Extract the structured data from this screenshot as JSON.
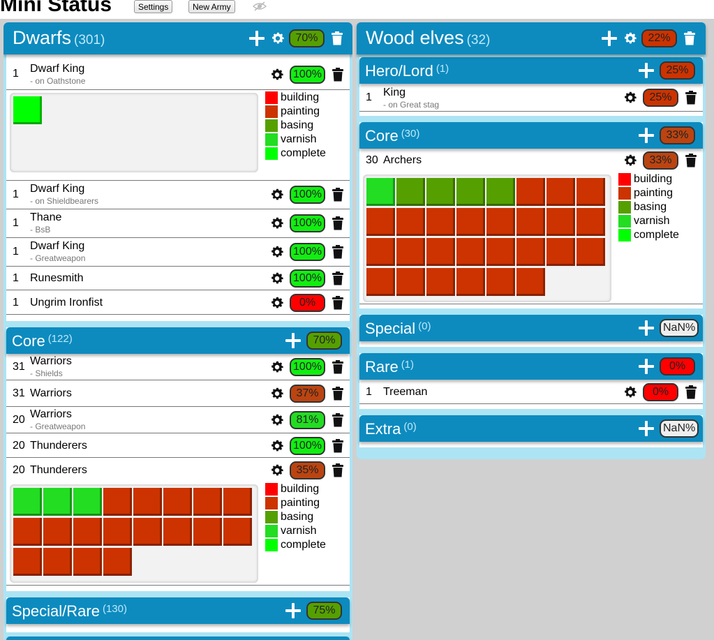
{
  "app": {
    "title": "Mini Status",
    "settings_label": "Settings",
    "new_army_label": "New Army"
  },
  "status_colors": {
    "building": "#ff0000",
    "painting": "#cc3300",
    "basing": "#55a000",
    "varnish": "#22dd22",
    "complete": "#00ff00"
  },
  "pct_colors": {
    "100%": "#11ee11",
    "81%": "#22dd22",
    "75%": "#55a000",
    "70%": "#55a000",
    "37%": "#bb4411",
    "35%": "#bb4411",
    "33%": "#bb4411",
    "25%": "#cc3300",
    "22%": "#cc3300",
    "0%": "#ff0000",
    "NaN%": "#eeeeee"
  },
  "legend": [
    "building",
    "painting",
    "basing",
    "varnish",
    "complete"
  ],
  "armies": [
    {
      "name": "Dwarfs",
      "count": "(301)",
      "pct": "70%",
      "sections": [
        {
          "name": "",
          "count": "",
          "pct": "",
          "units": [
            {
              "qty": "1",
              "name": "Dwarf King",
              "sub": "- on Oathstone",
              "pct": "100%",
              "grid": [
                "complete"
              ]
            },
            {
              "qty": "1",
              "name": "Dwarf King",
              "sub": "- on Shieldbearers",
              "pct": "100%"
            },
            {
              "qty": "1",
              "name": "Thane",
              "sub": "- BsB",
              "pct": "100%"
            },
            {
              "qty": "1",
              "name": "Dwarf King",
              "sub": "- Greatweapon",
              "pct": "100%"
            },
            {
              "qty": "1",
              "name": "Runesmith",
              "sub": "",
              "pct": "100%"
            },
            {
              "qty": "1",
              "name": "Ungrim Ironfist",
              "sub": "",
              "pct": "0%"
            }
          ]
        },
        {
          "name": "Core",
          "count": "(122)",
          "pct": "70%",
          "units": [
            {
              "qty": "31",
              "name": "Warriors",
              "sub": "- Shields",
              "pct": "100%"
            },
            {
              "qty": "31",
              "name": "Warriors",
              "sub": "",
              "pct": "37%"
            },
            {
              "qty": "20",
              "name": "Warriors",
              "sub": "- Greatweapon",
              "pct": "81%"
            },
            {
              "qty": "20",
              "name": "Thunderers",
              "sub": "",
              "pct": "100%"
            },
            {
              "qty": "20",
              "name": "Thunderers",
              "sub": "",
              "pct": "35%",
              "grid": [
                "varnish",
                "varnish",
                "varnish",
                "painting",
                "painting",
                "painting",
                "painting",
                "painting",
                "painting",
                "painting",
                "painting",
                "painting",
                "painting",
                "painting",
                "painting",
                "painting",
                "painting",
                "painting",
                "painting",
                "painting"
              ]
            }
          ]
        },
        {
          "name": "Special/Rare",
          "count": "(130)",
          "pct": "75%",
          "units": []
        }
      ]
    },
    {
      "name": "Wood elves",
      "count": "(32)",
      "pct": "22%",
      "sections": [
        {
          "name": "Hero/Lord",
          "count": "(1)",
          "pct": "25%",
          "units": [
            {
              "qty": "1",
              "name": "King",
              "sub": "- on Great stag",
              "pct": "25%"
            }
          ]
        },
        {
          "name": "Core",
          "count": "(30)",
          "pct": "33%",
          "units": [
            {
              "qty": "30",
              "name": "Archers",
              "sub": "",
              "pct": "33%",
              "grid": [
                "varnish",
                "basing",
                "basing",
                "basing",
                "basing",
                "painting",
                "painting",
                "painting",
                "painting",
                "painting",
                "painting",
                "painting",
                "painting",
                "painting",
                "painting",
                "painting",
                "painting",
                "painting",
                "painting",
                "painting",
                "painting",
                "painting",
                "painting",
                "painting",
                "painting",
                "painting",
                "painting",
                "painting",
                "painting",
                "painting"
              ]
            }
          ]
        },
        {
          "name": "Special",
          "count": "(0)",
          "pct": "NaN%",
          "units": []
        },
        {
          "name": "Rare",
          "count": "(1)",
          "pct": "0%",
          "units": [
            {
              "qty": "1",
              "name": "Treeman",
              "sub": "",
              "pct": "0%"
            }
          ]
        },
        {
          "name": "Extra",
          "count": "(0)",
          "pct": "NaN%",
          "units": []
        }
      ]
    }
  ]
}
